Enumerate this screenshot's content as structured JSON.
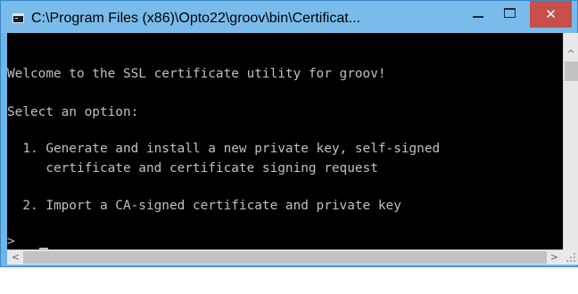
{
  "window": {
    "title": "C:\\Program Files (x86)\\Opto22\\groov\\bin\\Certificat...",
    "minimize_glyph": "",
    "close_glyph": "✕"
  },
  "console": {
    "lines": [
      "Welcome to the SSL certificate utility for groov!",
      "Select an option:",
      "  1. Generate and install a new private key, self-signed",
      "     certificate and certificate signing request",
      "  2. Import a CA-signed certificate and private key",
      ">"
    ]
  },
  "scrollbars": {
    "up_arrow": "^",
    "down_arrow": "v",
    "left_arrow": "<",
    "right_arrow": ">"
  },
  "colors": {
    "console_bg": "#000000",
    "console_text": "#c0c0c0",
    "titlebar": "#79bcec",
    "close_button": "#c7504a"
  },
  "icons": {
    "app": "console-window-icon",
    "minimize": "minimize-icon",
    "maximize": "maximize-icon",
    "close": "close-icon"
  }
}
